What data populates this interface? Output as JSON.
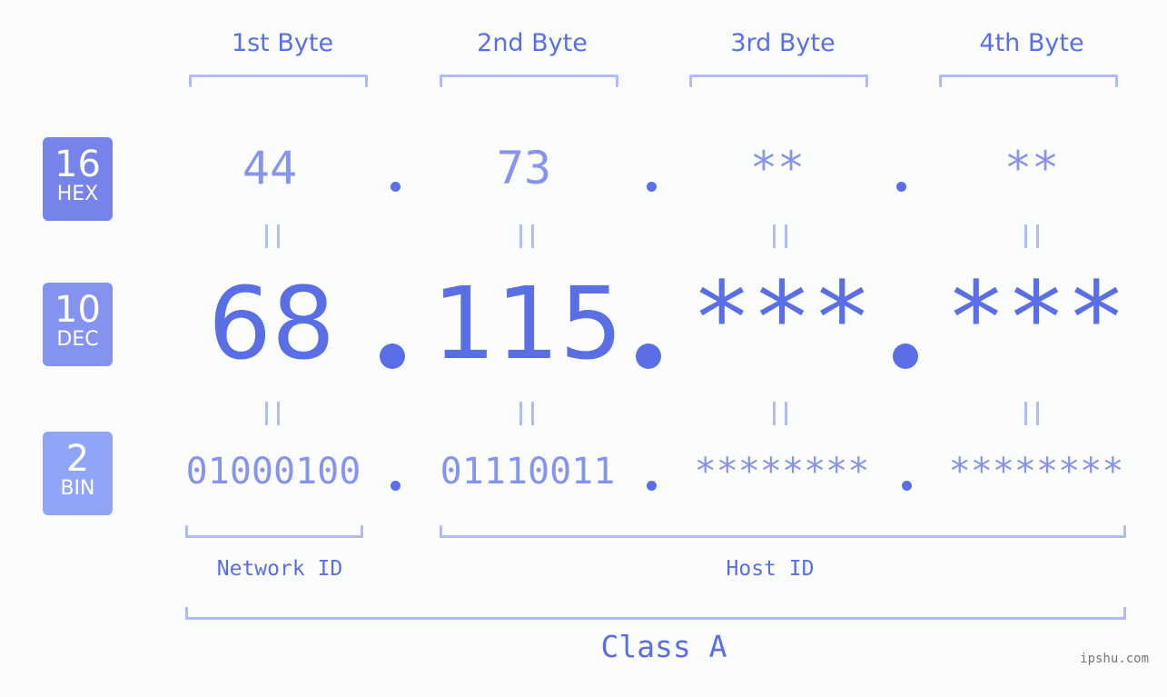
{
  "byte_headers": [
    "1st Byte",
    "2nd Byte",
    "3rd Byte",
    "4th Byte"
  ],
  "badges": {
    "hex": {
      "num": "16",
      "label": "HEX",
      "color": "#7583eb"
    },
    "dec": {
      "num": "10",
      "label": "DEC",
      "color": "#8593f0"
    },
    "bin": {
      "num": "2",
      "label": "BIN",
      "color": "#90a5f7"
    }
  },
  "hex": [
    "44",
    "73",
    "**",
    "**"
  ],
  "dec": [
    "68",
    "115",
    "***",
    "***"
  ],
  "bin": [
    "01000100",
    "01110011",
    "********",
    "********"
  ],
  "separator": ".",
  "network_id_label": "Network ID",
  "host_id_label": "Host ID",
  "class_label": "Class A",
  "watermark": "ipshu.com",
  "colors": {
    "primary": "#5a6ee6",
    "secondary": "#8794ee",
    "bracket": "#b1bbf7",
    "background": "#fbfdfc"
  }
}
